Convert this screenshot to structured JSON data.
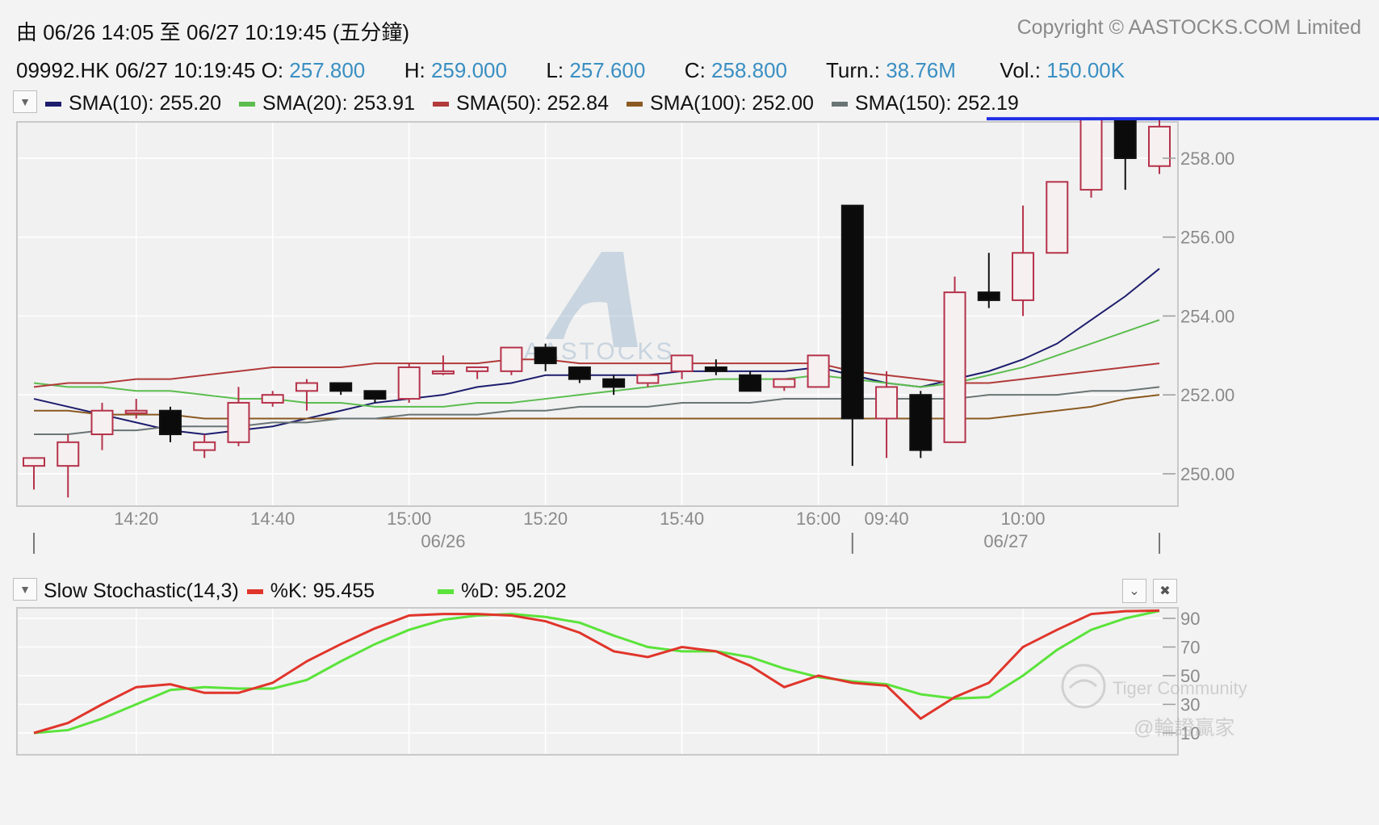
{
  "header": {
    "range_label": "由  06/26 14:05 至  06/27 10:19:45 (五分鐘)",
    "copyright": "Copyright © AASTOCKS.COM Limited"
  },
  "quote": {
    "symbol_time": "09992.HK 06/27 10:19:45",
    "o_label": "O:",
    "o_value": "257.800",
    "h_label": "H:",
    "h_value": "259.000",
    "l_label": "L:",
    "l_value": "257.600",
    "c_label": "C:",
    "c_value": "258.800",
    "turn_label": "Turn.:",
    "turn_value": "38.76M",
    "vol_label": "Vol.:",
    "vol_value": "150.00K"
  },
  "sma_legend": [
    {
      "label": "SMA(10): 255.20",
      "color": "#1d1d6e"
    },
    {
      "label": "SMA(20): 253.91",
      "color": "#5cbd4f"
    },
    {
      "label": "SMA(50): 252.84",
      "color": "#b23a3a"
    },
    {
      "label": "SMA(100): 252.00",
      "color": "#8a5a22"
    },
    {
      "label": "SMA(150): 252.19",
      "color": "#6a7474"
    }
  ],
  "stoch_legend": {
    "title": "Slow Stochastic(14,3)",
    "k_label": "%K: 95.455",
    "k_color": "#e0352b",
    "d_label": "%D: 95.202",
    "d_color": "#5be33b"
  },
  "watermarks": {
    "center": "AASTOCKS",
    "tiger": "Tiger Community",
    "chinese": "@輪證贏家"
  },
  "icons": {
    "dropdown": "triangle-down-icon",
    "collapse": "chevron-down-icon",
    "close": "close-icon"
  },
  "chart_data": [
    {
      "type": "candlestick",
      "title": "",
      "x_tick_labels": [
        "14:20",
        "14:40",
        "15:00",
        "15:20",
        "15:40",
        "16:00",
        "09:40",
        "10:00"
      ],
      "date_labels": [
        "06/26",
        "06/27"
      ],
      "y_ticks": [
        250,
        252,
        254,
        256,
        258
      ],
      "y_tick_labels": [
        "250.00",
        "252.00",
        "254.00",
        "256.00",
        "258.00"
      ],
      "ylim": [
        249.2,
        258.9
      ],
      "grid": true,
      "last_price_line": 259.0,
      "candles": [
        {
          "o": 250.2,
          "h": 250.4,
          "l": 249.6,
          "c": 250.4
        },
        {
          "o": 250.2,
          "h": 251.0,
          "l": 249.4,
          "c": 250.8
        },
        {
          "o": 251.0,
          "h": 251.8,
          "l": 250.6,
          "c": 251.6
        },
        {
          "o": 251.6,
          "h": 251.9,
          "l": 251.4,
          "c": 251.6
        },
        {
          "o": 251.6,
          "h": 251.7,
          "l": 250.8,
          "c": 251.0
        },
        {
          "o": 250.6,
          "h": 251.0,
          "l": 250.4,
          "c": 250.8
        },
        {
          "o": 250.8,
          "h": 252.2,
          "l": 250.7,
          "c": 251.8
        },
        {
          "o": 251.8,
          "h": 252.1,
          "l": 251.7,
          "c": 252.0
        },
        {
          "o": 252.1,
          "h": 252.4,
          "l": 251.6,
          "c": 252.3
        },
        {
          "o": 252.3,
          "h": 252.3,
          "l": 252.0,
          "c": 252.1
        },
        {
          "o": 252.1,
          "h": 252.1,
          "l": 251.8,
          "c": 251.9
        },
        {
          "o": 251.9,
          "h": 252.8,
          "l": 251.8,
          "c": 252.7
        },
        {
          "o": 252.6,
          "h": 253.0,
          "l": 252.5,
          "c": 252.6
        },
        {
          "o": 252.6,
          "h": 252.7,
          "l": 252.4,
          "c": 252.7
        },
        {
          "o": 252.6,
          "h": 253.2,
          "l": 252.5,
          "c": 253.2
        },
        {
          "o": 253.2,
          "h": 253.3,
          "l": 252.6,
          "c": 252.8
        },
        {
          "o": 252.7,
          "h": 252.7,
          "l": 252.3,
          "c": 252.4
        },
        {
          "o": 252.4,
          "h": 252.5,
          "l": 252.0,
          "c": 252.2
        },
        {
          "o": 252.3,
          "h": 252.5,
          "l": 252.2,
          "c": 252.5
        },
        {
          "o": 252.6,
          "h": 253.0,
          "l": 252.4,
          "c": 253.0
        },
        {
          "o": 252.7,
          "h": 252.9,
          "l": 252.5,
          "c": 252.6
        },
        {
          "o": 252.5,
          "h": 252.6,
          "l": 252.1,
          "c": 252.1
        },
        {
          "o": 252.2,
          "h": 252.4,
          "l": 252.1,
          "c": 252.4
        },
        {
          "o": 252.2,
          "h": 253.0,
          "l": 252.2,
          "c": 253.0
        },
        {
          "o": 256.8,
          "h": 256.8,
          "l": 250.2,
          "c": 251.4
        },
        {
          "o": 251.4,
          "h": 252.6,
          "l": 250.4,
          "c": 252.2
        },
        {
          "o": 252.0,
          "h": 252.1,
          "l": 250.4,
          "c": 250.6
        },
        {
          "o": 250.8,
          "h": 255.0,
          "l": 250.8,
          "c": 254.6
        },
        {
          "o": 254.6,
          "h": 255.6,
          "l": 254.2,
          "c": 254.4
        },
        {
          "o": 254.4,
          "h": 256.8,
          "l": 254.0,
          "c": 255.6
        },
        {
          "o": 255.6,
          "h": 257.4,
          "l": 255.6,
          "c": 257.4
        },
        {
          "o": 257.2,
          "h": 259.0,
          "l": 257.0,
          "c": 259.0
        },
        {
          "o": 259.0,
          "h": 259.0,
          "l": 257.2,
          "c": 258.0
        },
        {
          "o": 257.8,
          "h": 259.0,
          "l": 257.6,
          "c": 258.8
        }
      ],
      "series": [
        {
          "name": "SMA(10)",
          "color": "#1d1d6e",
          "values": [
            251.9,
            251.7,
            251.5,
            251.3,
            251.1,
            251.0,
            251.1,
            251.2,
            251.4,
            251.6,
            251.8,
            251.9,
            252.0,
            252.2,
            252.3,
            252.5,
            252.5,
            252.5,
            252.5,
            252.6,
            252.6,
            252.6,
            252.6,
            252.7,
            252.5,
            252.3,
            252.2,
            252.4,
            252.6,
            252.9,
            253.3,
            253.9,
            254.5,
            255.2
          ]
        },
        {
          "name": "SMA(20)",
          "color": "#5cbd4f",
          "values": [
            252.3,
            252.2,
            252.2,
            252.1,
            252.1,
            252.0,
            251.9,
            251.9,
            251.8,
            251.8,
            251.7,
            251.7,
            251.7,
            251.8,
            251.8,
            251.9,
            252.0,
            252.1,
            252.2,
            252.3,
            252.4,
            252.4,
            252.4,
            252.5,
            252.4,
            252.3,
            252.2,
            252.3,
            252.5,
            252.7,
            253.0,
            253.3,
            253.6,
            253.9
          ]
        },
        {
          "name": "SMA(50)",
          "color": "#b23a3a",
          "values": [
            252.2,
            252.3,
            252.3,
            252.4,
            252.4,
            252.5,
            252.6,
            252.7,
            252.7,
            252.7,
            252.8,
            252.8,
            252.8,
            252.8,
            252.9,
            252.9,
            252.8,
            252.8,
            252.8,
            252.8,
            252.8,
            252.8,
            252.8,
            252.8,
            252.6,
            252.5,
            252.4,
            252.3,
            252.3,
            252.4,
            252.5,
            252.6,
            252.7,
            252.8
          ]
        },
        {
          "name": "SMA(100)",
          "color": "#8a5a22",
          "values": [
            251.6,
            251.6,
            251.5,
            251.5,
            251.5,
            251.4,
            251.4,
            251.4,
            251.4,
            251.4,
            251.4,
            251.4,
            251.4,
            251.4,
            251.4,
            251.4,
            251.4,
            251.4,
            251.4,
            251.4,
            251.4,
            251.4,
            251.4,
            251.4,
            251.4,
            251.4,
            251.4,
            251.4,
            251.4,
            251.5,
            251.6,
            251.7,
            251.9,
            252.0
          ]
        },
        {
          "name": "SMA(150)",
          "color": "#6a7474",
          "values": [
            251.0,
            251.0,
            251.1,
            251.1,
            251.2,
            251.2,
            251.2,
            251.3,
            251.3,
            251.4,
            251.4,
            251.5,
            251.5,
            251.5,
            251.6,
            251.6,
            251.7,
            251.7,
            251.7,
            251.8,
            251.8,
            251.8,
            251.9,
            251.9,
            251.9,
            251.9,
            251.9,
            251.9,
            252.0,
            252.0,
            252.0,
            252.1,
            252.1,
            252.2
          ]
        }
      ]
    },
    {
      "type": "line",
      "title": "Slow Stochastic(14,3)",
      "y_ticks": [
        10,
        30,
        50,
        70,
        90
      ],
      "y_tick_labels": [
        "10",
        "30",
        "50",
        "70",
        "90"
      ],
      "ylim": [
        0,
        100
      ],
      "grid": true,
      "series": [
        {
          "name": "%K",
          "color": "#e0352b",
          "values": [
            10,
            17,
            30,
            42,
            44,
            38,
            38,
            45,
            60,
            72,
            83,
            92,
            93,
            93,
            92,
            88,
            80,
            67,
            63,
            70,
            67,
            57,
            42,
            50,
            45,
            43,
            20,
            35,
            45,
            70,
            82,
            93,
            95,
            95.455
          ]
        },
        {
          "name": "%D",
          "color": "#5be33b",
          "values": [
            10,
            12,
            20,
            30,
            40,
            42,
            41,
            41,
            47,
            60,
            72,
            82,
            89,
            92,
            93,
            91,
            87,
            78,
            70,
            67,
            67,
            63,
            55,
            49,
            46,
            44,
            37,
            34,
            35,
            50,
            68,
            82,
            90,
            95.202
          ]
        }
      ]
    }
  ]
}
